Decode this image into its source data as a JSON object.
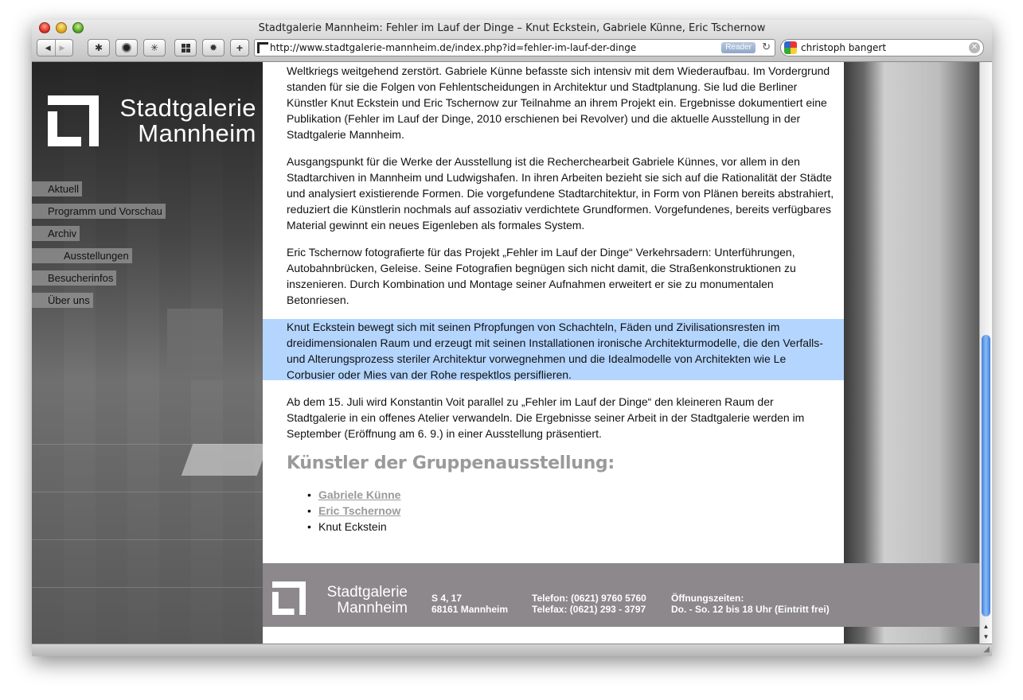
{
  "window": {
    "title": "Stadtgalerie Mannheim: Fehler im Lauf der Dinge – Knut Eckstein, Gabriele Künne, Eric Tschernow"
  },
  "toolbar": {
    "url": "http://www.stadtgalerie-mannheim.de/index.php?id=fehler-im-lauf-der-dinge",
    "reader_label": "Reader",
    "search_value": "christoph bangert",
    "add_label": "+"
  },
  "site": {
    "logo_line1": "Stadtgalerie",
    "logo_line2": "Mannheim"
  },
  "nav": {
    "items": [
      {
        "label": "Aktuell"
      },
      {
        "label": "Programm und Vorschau"
      },
      {
        "label": "Archiv"
      },
      {
        "label": "Ausstellungen"
      },
      {
        "label": "Besucherinfos"
      },
      {
        "label": "Über uns"
      }
    ]
  },
  "article": {
    "paragraphs": [
      "Weltkriegs weitgehend zerstört. Gabriele Künne befasste sich intensiv mit dem Wiederaufbau. Im Vordergrund standen für sie die Folgen von Fehlentscheidungen in Architektur und Stadtplanung. Sie lud die Berliner Künstler Knut Eckstein und Eric Tschernow zur Teilnahme an ihrem Projekt ein. Ergebnisse dokumentiert eine Publikation (Fehler im Lauf der Dinge, 2010 erschienen bei Revolver) und die aktuelle Ausstellung in der Stadtgalerie Mannheim.",
      "Ausgangspunkt für die Werke der Ausstellung ist die Recherchearbeit Gabriele Künnes, vor allem in den Stadtarchiven in Mannheim und Ludwigshafen. In ihren Arbeiten bezieht sie sich auf die Rationalität der Städte und analysiert existierende Formen. Die vorgefundene Stadtarchitektur, in Form von Plänen bereits abstrahiert, reduziert  die Künstlerin nochmals auf assoziativ verdichtete Grundformen. Vorgefundenes, bereits verfügbares Material gewinnt ein neues Eigenleben als formales System.",
      "Eric Tschernow fotografierte für das Projekt „Fehler im Lauf der Dinge“ Verkehrsadern: Unterführungen, Autobahnbrücken, Geleise. Seine Fotografien begnügen sich nicht damit, die Straßenkonstruktionen zu inszenieren. Durch Kombination und Montage seiner Aufnahmen erweitert er sie zu monumentalen Betonriesen.",
      "Knut Eckstein bewegt sich mit seinen Pfropfungen von Schachteln, Fäden und Zivilisationsresten im dreidimensionalen Raum und erzeugt mit seinen Installationen ironische Architekturmodelle, die den Verfalls- und Alterungsprozess steriler Architektur vorwegnehmen und die Idealmodelle von Architekten wie Le Corbusier oder Mies van der Rohe respektlos persiflieren.",
      "Ab dem 15. Juli wird Konstantin Voit parallel zu „Fehler im Lauf der Dinge“ den kleineren Raum der Stadtgalerie in ein offenes Atelier verwandeln. Die Ergebnisse seiner Arbeit in der Stadtgalerie werden im September (Eröffnung am 6. 9.) in einer Ausstellung präsentiert."
    ],
    "artists_heading": "Künstler der Gruppenausstellung:",
    "artists": [
      {
        "name": "Gabriele Künne",
        "link": true
      },
      {
        "name": "Eric Tschernow",
        "link": true
      },
      {
        "name": "Knut Eckstein",
        "link": false
      }
    ]
  },
  "footer": {
    "address_line1": "S 4, 17",
    "address_line2": "68161 Mannheim",
    "phone": "Telefon: (0621) 9760 5760",
    "fax": "Telefax: (0621) 293 - 3797",
    "hours_label": "Öffnungszeiten:",
    "hours": "Do. - So. 12 bis 18 Uhr (Eintritt frei)"
  },
  "colors": {
    "selection": "#b4d5fe",
    "nav_bg": "#969696",
    "footer_bg": "#8c888b",
    "heading": "#9a9a9a",
    "scroll_thumb": "#3c7fe0"
  }
}
